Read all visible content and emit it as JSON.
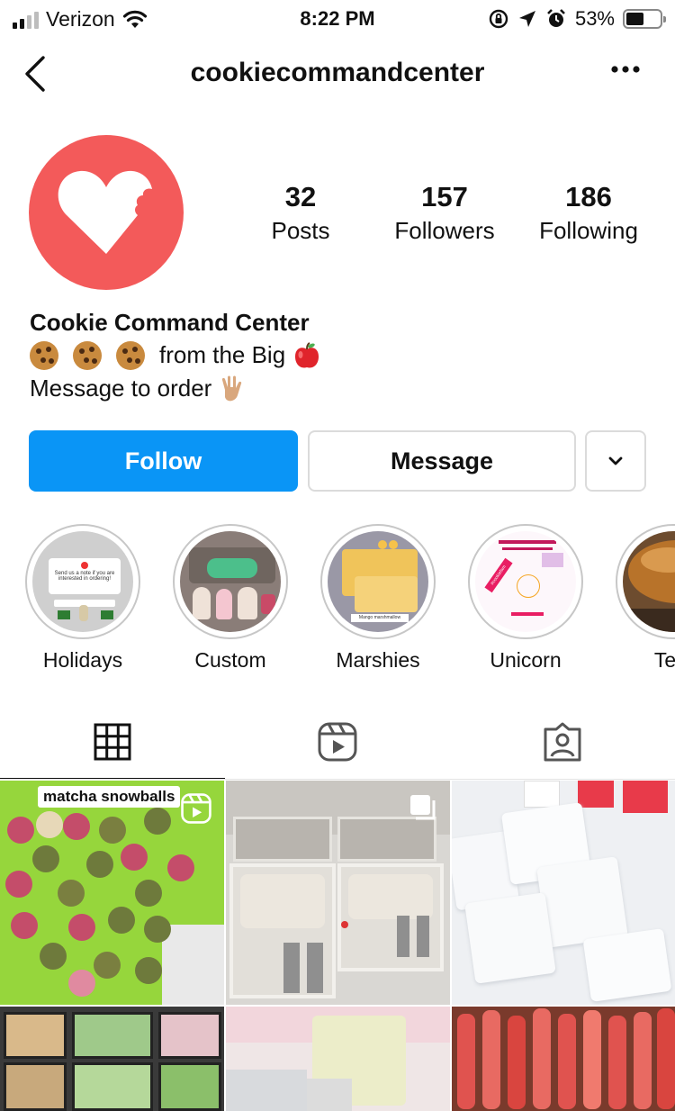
{
  "status_bar": {
    "carrier": "Verizon",
    "time": "8:22 PM",
    "battery": "53%",
    "battery_level": 0.53
  },
  "header": {
    "username": "cookiecommandcenter"
  },
  "profile": {
    "stats": [
      {
        "value": "32",
        "label": "Posts"
      },
      {
        "value": "157",
        "label": "Followers"
      },
      {
        "value": "186",
        "label": "Following"
      }
    ],
    "display_name": "Cookie Command Center",
    "bio_line1_text": "from the Big",
    "bio_line2_text": "Message to order",
    "avatar_color": "#f35a5a"
  },
  "actions": {
    "follow_label": "Follow",
    "message_label": "Message",
    "follow_color": "#0a95f6"
  },
  "highlights": [
    {
      "label": "Holidays"
    },
    {
      "label": "Custom"
    },
    {
      "label": "Marshies"
    },
    {
      "label": "Unicorn"
    },
    {
      "label": "Test"
    }
  ],
  "highlight_texts": {
    "holidays_note": "Send us a note if you are interested in ordering!",
    "marshies_caption": "Mango marshmallow",
    "unicorn_tag": "#cookiefam"
  },
  "tabs": [
    {
      "icon": "grid-icon",
      "active": true
    },
    {
      "icon": "reels-icon",
      "active": false
    },
    {
      "icon": "tagged-icon",
      "active": false
    }
  ],
  "posts": [
    {
      "caption": "matcha snowballs",
      "type": "reel"
    },
    {
      "caption": "",
      "type": "carousel"
    },
    {
      "caption": "",
      "type": "photo"
    },
    {
      "caption": "",
      "type": "photo"
    },
    {
      "caption": "",
      "type": "photo"
    },
    {
      "caption": "",
      "type": "photo"
    }
  ]
}
